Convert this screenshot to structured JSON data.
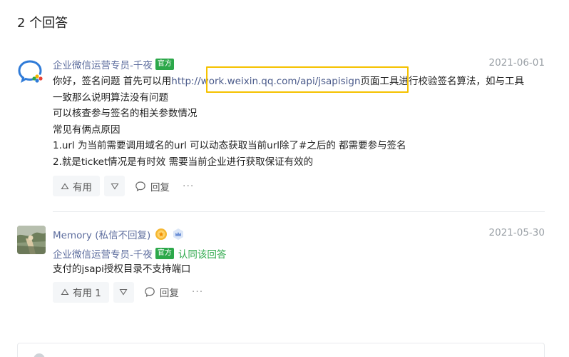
{
  "answers_title": "2 个回答",
  "answers": [
    {
      "author": "企业微信运营专员-千夜",
      "official_badge": "官方",
      "date": "2021-06-01",
      "text_prefix": "你好，签名问题 首先可以用",
      "link": "http://work.weixin.qq.com/api/jsapisign",
      "text_suffix": "页面工具进行校验签名算法，如与工具",
      "lines": [
        "一致那么说明算法没有问题",
        "可以核查参与签名的相关参数情况",
        "常见有俩点原因",
        "1.url 为当前需要调用域名的url 可以动态获取当前url除了#之后的 都需要参与签名",
        "2.就是ticket情况是有时效 需要当前企业进行获取保证有效的"
      ],
      "useful_label": "有用",
      "reply_label": "回复",
      "more_label": "···"
    },
    {
      "author": "Memory (私信不回复)",
      "date": "2021-05-30",
      "endorser": "企业微信运营专员-千夜",
      "official_badge": "官方",
      "endorse_text": "认同该回答",
      "text": "支付的jsapi授权目录不支持端口",
      "useful_label": "有用 1",
      "reply_label": "回复",
      "more_label": "···"
    }
  ],
  "colors": {
    "official_green": "#2ca84a",
    "author_blue": "#5d6d9e",
    "highlight_yellow": "#f5c200"
  }
}
